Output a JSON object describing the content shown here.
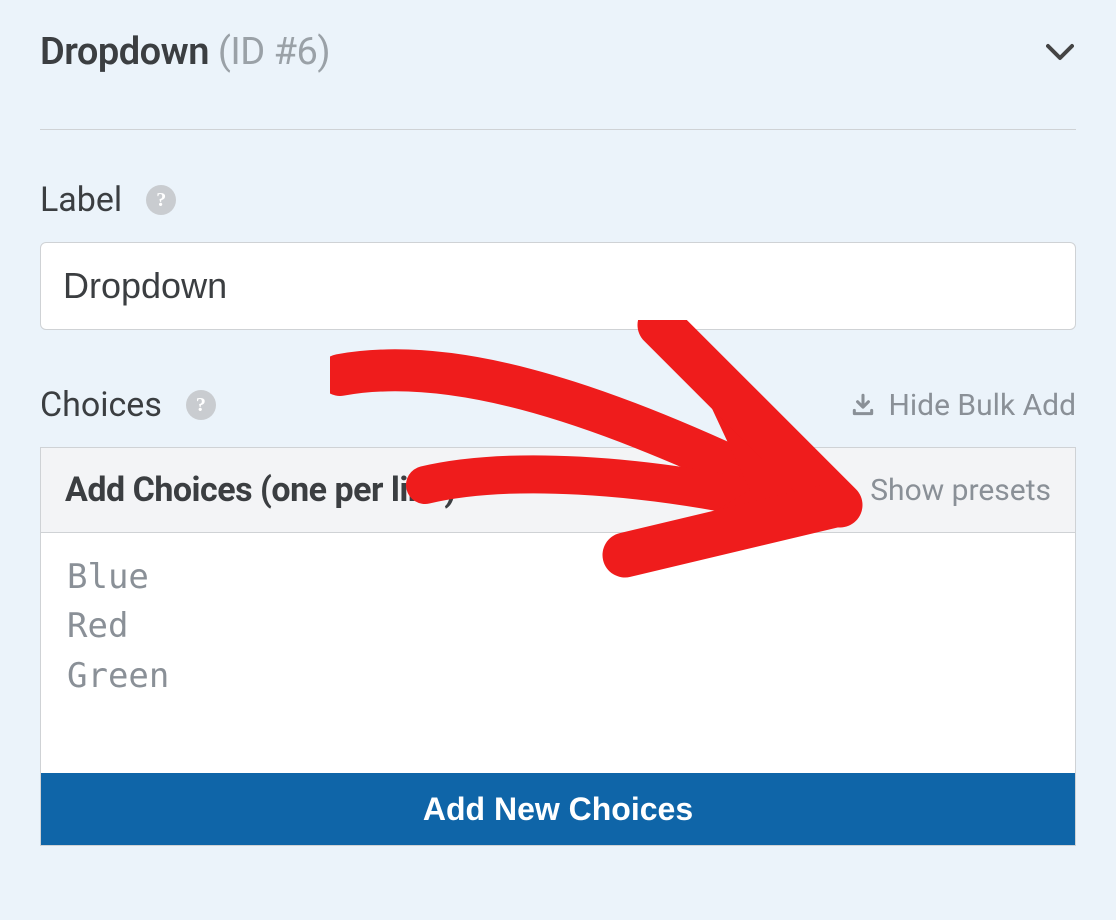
{
  "header": {
    "title": "Dropdown",
    "id_label": "(ID #6)"
  },
  "label_section": {
    "label": "Label",
    "input_value": "Dropdown"
  },
  "choices_section": {
    "label": "Choices",
    "hide_bulk_label": "Hide Bulk Add",
    "bulk_title": "Add Choices (one per line)",
    "show_presets_label": "Show presets",
    "textarea_placeholder": "Blue\nRed\nGreen",
    "add_button_label": "Add New Choices"
  }
}
